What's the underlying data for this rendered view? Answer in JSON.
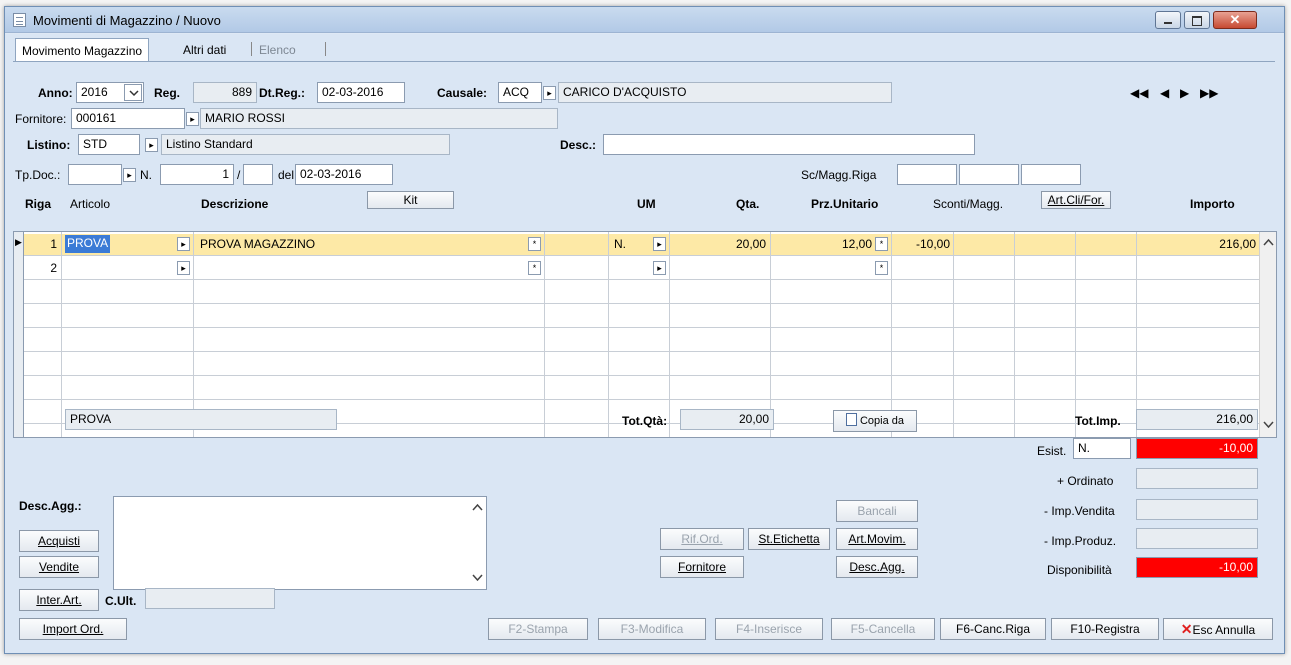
{
  "window": {
    "title": "Movimenti di Magazzino / Nuovo"
  },
  "tabs": [
    {
      "label": "Movimento Magazzino"
    },
    {
      "label": "Altri dati"
    },
    {
      "label": "Elenco"
    }
  ],
  "header": {
    "anno_label": "Anno:",
    "anno": "2016",
    "reg_label": "Reg.",
    "reg": "889",
    "dtreg_label": "Dt.Reg.:",
    "dtreg": "02-03-2016",
    "causale_label": "Causale:",
    "causale_code": "ACQ",
    "causale_desc": "CARICO D'ACQUISTO",
    "fornitore_label": "Fornitore:",
    "fornitore_code": "000161",
    "fornitore_name": "MARIO ROSSI",
    "listino_label": "Listino:",
    "listino_code": "STD",
    "listino_desc": "Listino Standard",
    "desc_label": "Desc.:",
    "desc": "",
    "tpdoc_label": "Tp.Doc.:",
    "n_label": "N.",
    "n_value": "1",
    "slash": "/",
    "del_label": "del",
    "del_date": "02-03-2016",
    "scmagg_label": "Sc/Magg.Riga"
  },
  "grid": {
    "headers": {
      "riga": "Riga",
      "articolo": "Articolo",
      "descrizione": "Descrizione",
      "kit": "Kit",
      "um": "UM",
      "qta": "Qta.",
      "prz": "Prz.Unitario",
      "sconti": "Sconti/Magg.",
      "artcli": "Art.Cli/For.",
      "importo": "Importo"
    },
    "rows": [
      {
        "riga": "1",
        "articolo": "PROVA",
        "descrizione": "PROVA MAGAZZINO",
        "um": "N.",
        "qta": "20,00",
        "prz": "12,00",
        "sconto": "-10,00",
        "importo": "216,00"
      },
      {
        "riga": "2",
        "articolo": "",
        "descrizione": "",
        "um": "",
        "qta": "",
        "prz": "",
        "sconto": "",
        "importo": ""
      }
    ]
  },
  "footer": {
    "article_name": "PROVA",
    "totqta_label": "Tot.Qtà:",
    "totqta": "20,00",
    "copia_da": "Copia da",
    "totimp_label": "Tot.Imp.",
    "totimp": "216,00",
    "esist_label": "Esist.",
    "esist_um": "N.",
    "esist": "-10,00",
    "ordinato_label": "+ Ordinato",
    "impvendita_label": "- Imp.Vendita",
    "impproduz_label": "- Imp.Produz.",
    "disponibilita_label": "Disponibilità",
    "disponibilita": "-10,00",
    "descagg_label": "Desc.Agg.:",
    "acquisti": "Acquisti",
    "vendite": "Vendite",
    "interart": "Inter.Art.",
    "cult_label": "C.Ult.",
    "import_ord": "Import Ord.",
    "bancali": "Bancali",
    "rif_ord": "Rif.Ord.",
    "st_etichetta": "St.Etichetta",
    "art_movim": "Art.Movim.",
    "fornitore_btn": "Fornitore",
    "desc_agg_btn": "Desc.Agg.",
    "f2": "F2-Stampa",
    "f3": "F3-Modifica",
    "f4": "F4-Inserisce",
    "f5": "F5-Cancella",
    "f6": "F6-Canc.Riga",
    "f10": "F10-Registra",
    "esc": "Esc Annulla"
  },
  "colors": {
    "accent_row": "#fde9a6",
    "negative_bg": "#ff0000"
  }
}
